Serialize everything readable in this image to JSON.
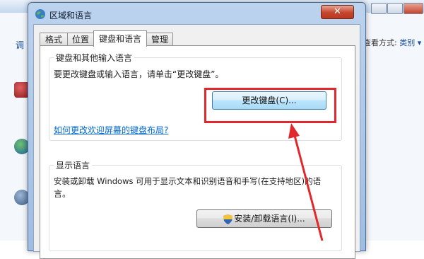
{
  "background": {
    "view_by_label": "查看方式:",
    "view_by_value": "类别",
    "left_text": "调"
  },
  "dialog": {
    "title": "区域和语言",
    "tabs": [
      {
        "label": "格式"
      },
      {
        "label": "位置"
      },
      {
        "label": "键盘和语言"
      },
      {
        "label": "管理"
      }
    ],
    "keyboard_group": {
      "title": "键盘和其他输入语言",
      "description": "要更改键盘或输入语言，请单击“更改键盘”。",
      "change_keyboard_button": "更改键盘(C)...",
      "help_link": "如何更改欢迎屏幕的键盘布局?"
    },
    "display_group": {
      "title": "显示语言",
      "description_line1": "安装或卸载 Windows 可用于显示文本和识别语音和手写(在支持地区)的语",
      "description_line2": "言。",
      "install_button": "安装/卸载语言(I)..."
    }
  },
  "colors": {
    "highlight": "#e1282c",
    "link": "#0066cc"
  }
}
